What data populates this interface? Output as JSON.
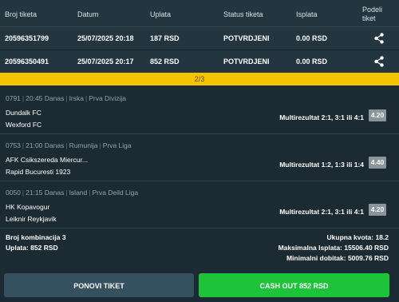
{
  "header": {
    "col_ticket": "Broj tiketa",
    "col_date": "Datum",
    "col_payment": "Uplata",
    "col_status": "Status tiketa",
    "col_payout": "Isplata",
    "col_share_1": "Podeli",
    "col_share_2": "tiket"
  },
  "tickets": [
    {
      "id": "20596351799",
      "date": "25/07/2025 20:18",
      "payment": "187 RSD",
      "status": "POTVRDJENI",
      "payout": "0.00 RSD"
    },
    {
      "id": "20596350491",
      "date": "25/07/2025 20:17",
      "payment": "852 RSD",
      "status": "POTVRDJENI",
      "payout": "0.00 RSD"
    }
  ],
  "pager": {
    "label": "2/3"
  },
  "events": [
    {
      "code": "0791",
      "time": "20:45 Danas",
      "country": "Irska",
      "league": "Prva Divizija",
      "home": "Dundalk FC",
      "away": "Wexford FC",
      "market": "Multirezultat 2:1, 3:1 ili 4:1",
      "odd": "4.20"
    },
    {
      "code": "0753",
      "time": "21:00 Danas",
      "country": "Rumunija",
      "league": "Prva Liga",
      "home": "AFK Csikszereda Miercur...",
      "away": "Rapid Bucuresti 1923",
      "market": "Multirezultat 1:2, 1:3 ili 1:4",
      "odd": "4.40"
    },
    {
      "code": "0050",
      "time": "21:15 Danas",
      "country": "Island",
      "league": "Prva Deild Liga",
      "home": "HK Kopavogur",
      "away": "Leiknir Reykjavik",
      "market": "Multirezultat 2:1, 3:1 ili 4:1",
      "odd": "4.20"
    }
  ],
  "summary": {
    "combinations": "Broj kombinacija 3",
    "payment": "Uplata: 852 RSD",
    "total_odds": "Ukupna kvota: 18.2",
    "max_payout": "Maksimalna Isplata: 15506.40 RSD",
    "min_win": "Minimalni dobitak: 5009.76 RSD"
  },
  "buttons": {
    "repeat": "PONOVI TIKET",
    "cashout": "CASH OUT 852 RSD"
  },
  "colors": {
    "accent_yellow": "#f5c400",
    "cashout_green": "#1dc43a",
    "odd_badge": "#8a9499"
  }
}
